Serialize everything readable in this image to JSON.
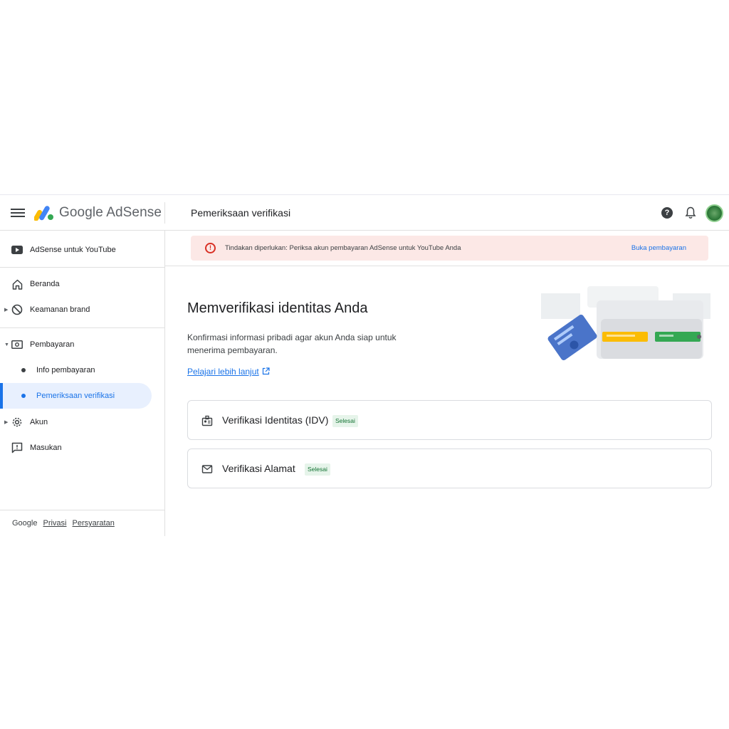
{
  "header": {
    "brand_google": "Google",
    "brand_product": "AdSense",
    "page_title": "Pemeriksaan verifikasi",
    "help_glyph": "?"
  },
  "sidebar": {
    "items": [
      {
        "label": "AdSense untuk YouTube",
        "icon": "youtube-icon"
      },
      {
        "label": "Beranda",
        "icon": "home-icon"
      },
      {
        "label": "Keamanan brand",
        "icon": "block-icon"
      },
      {
        "label": "Pembayaran",
        "icon": "payments-icon"
      },
      {
        "label": "Info pembayaran"
      },
      {
        "label": "Pemeriksaan verifikasi",
        "active": true
      },
      {
        "label": "Akun",
        "icon": "gear-icon"
      },
      {
        "label": "Masukan",
        "icon": "feedback-icon"
      }
    ],
    "footer": {
      "google": "Google",
      "privacy": "Privasi",
      "terms": "Persyaratan"
    }
  },
  "banner": {
    "icon": "!",
    "text": "Tindakan diperlukan: Periksa akun pembayaran AdSense untuk YouTube Anda",
    "action": "Buka pembayaran"
  },
  "main": {
    "title": "Memverifikasi identitas Anda",
    "description": "Konfirmasi informasi pribadi agar akun Anda siap untuk menerima pembayaran.",
    "learn_more": "Pelajari lebih lanjut",
    "cards": [
      {
        "title": "Verifikasi Identitas (IDV)",
        "status": "Selesai",
        "icon": "id-badge-icon"
      },
      {
        "title": "Verifikasi Alamat",
        "status": "Selesai",
        "icon": "mail-icon"
      }
    ]
  },
  "colors": {
    "accent": "#1a73e8",
    "error": "#d93025",
    "success_bg": "#e6f4ea",
    "success_text": "#137333",
    "banner_bg": "#fce8e6"
  }
}
